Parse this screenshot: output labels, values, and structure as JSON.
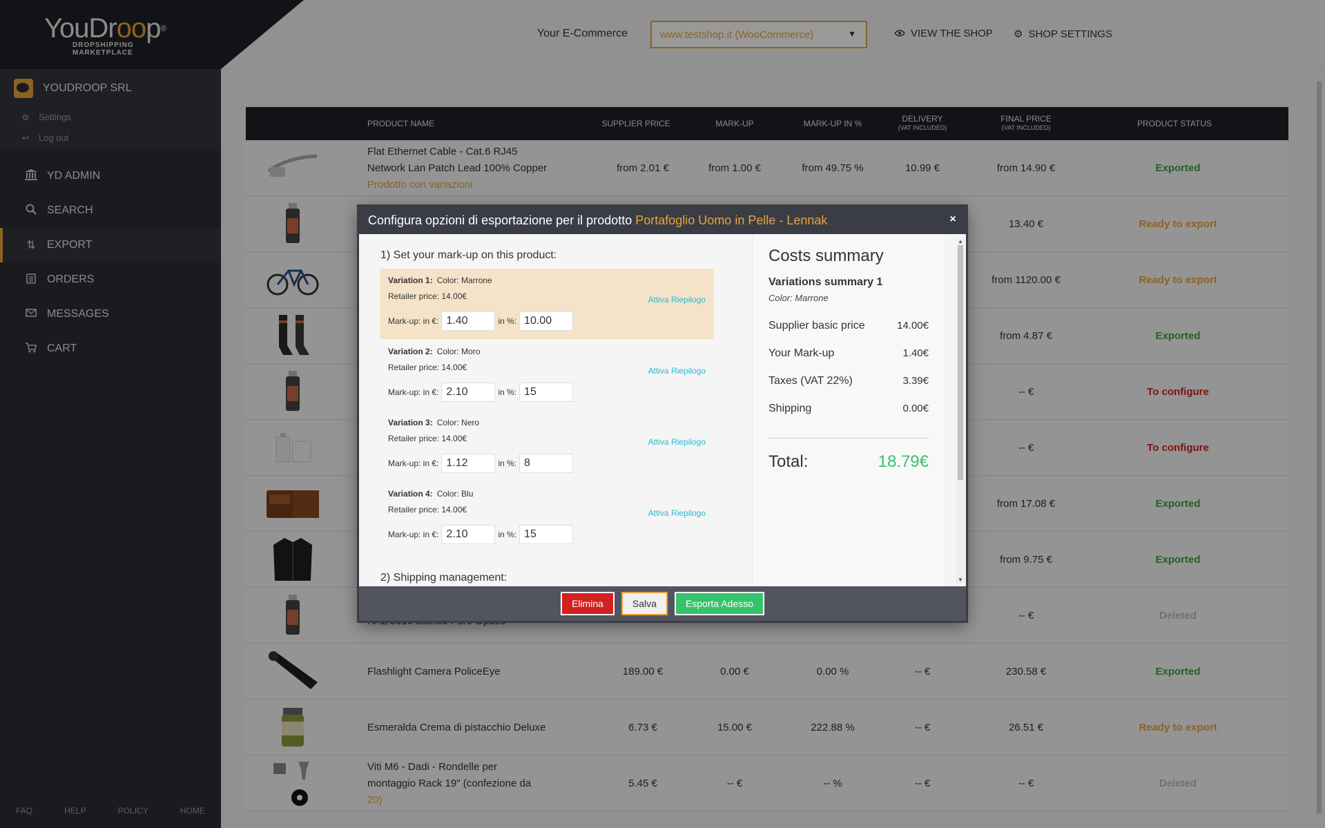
{
  "brand": {
    "name_a": "You",
    "name_b": "Dr",
    "name_c": "oo",
    "name_d": "p",
    "reg": "®",
    "tagline": "DROPSHIPPING MARKETPLACE"
  },
  "company": {
    "name": "YOUDROOP SRL",
    "settings": "Settings",
    "logout": "Log out"
  },
  "nav": [
    {
      "label": "YD ADMIN",
      "icon": "bank-icon"
    },
    {
      "label": "SEARCH",
      "icon": "search-icon"
    },
    {
      "label": "EXPORT",
      "icon": "export-icon"
    },
    {
      "label": "ORDERS",
      "icon": "clipboard-icon"
    },
    {
      "label": "MESSAGES",
      "icon": "mail-icon"
    },
    {
      "label": "CART",
      "icon": "cart-icon"
    }
  ],
  "footer": {
    "faq": "FAQ",
    "help": "HELP",
    "policy": "POLICY",
    "home": "HOME"
  },
  "topbar": {
    "shop_label": "Your E-Commerce",
    "shop_value": "www.testshop.it (WooCommerce)",
    "view_shop": "VIEW THE SHOP",
    "shop_settings": "SHOP SETTINGS"
  },
  "table": {
    "headers": {
      "name": "PRODUCT NAME",
      "supplier": "SUPPLIER PRICE",
      "markup": "MARK-UP",
      "markup_pct": "MARK-UP IN %",
      "delivery": "DELIVERY",
      "delivery_sub": "(VAT INCLUDED)",
      "final": "FINAL PRICE",
      "final_sub": "(VAT INCLUDED)",
      "status": "PRODUCT STATUS"
    },
    "rows": [
      {
        "name1": "Flat Ethernet Cable - Cat.6 RJ45",
        "name2": "Network Lan Patch Lead 100% Copper",
        "name3": "Prodotto con variazioni",
        "supplier": "from 2.01 €",
        "markup": "from 1.00 €",
        "markup_pct": "from 49.75 %",
        "delivery": "10.99 €",
        "final": "from 14.90 €",
        "status": "Exported",
        "status_type": "exported"
      },
      {
        "name1": "",
        "name2": "",
        "name3": "",
        "supplier": "",
        "markup": "",
        "markup_pct": "",
        "delivery": "",
        "final": "13.40 €",
        "status": "Ready to export",
        "status_type": "ready"
      },
      {
        "name1": "",
        "name2": "",
        "name3": "",
        "supplier": "",
        "markup": "",
        "markup_pct": "",
        "delivery": "",
        "final": "from 1120.00 €",
        "status": "Ready to export",
        "status_type": "ready"
      },
      {
        "name1": "",
        "name2": "",
        "name3": "",
        "supplier": "",
        "markup": "",
        "markup_pct": "",
        "delivery": "",
        "final": "from 4.87 €",
        "status": "Exported",
        "status_type": "exported"
      },
      {
        "name1": "",
        "name2": "",
        "name3": "",
        "supplier": "",
        "markup": "",
        "markup_pct": "",
        "delivery": "",
        "final": "-- €",
        "status": "To configure",
        "status_type": "config"
      },
      {
        "name1": "",
        "name2": "",
        "name3": "",
        "supplier": "",
        "markup": "",
        "markup_pct": "",
        "delivery": "",
        "final": "-- €",
        "status": "To configure",
        "status_type": "config"
      },
      {
        "name1": "",
        "name2": "",
        "name3": "",
        "supplier": "",
        "markup": "",
        "markup_pct": "",
        "delivery": "",
        "final": "from 17.08 €",
        "status": "Exported",
        "status_type": "exported"
      },
      {
        "name1": "",
        "name2": "",
        "name3": "",
        "supplier": "",
        "markup": "",
        "markup_pct": "",
        "delivery": "",
        "final": "from 9.75 €",
        "status": "Exported",
        "status_type": "exported"
      },
      {
        "name1": "",
        "name2": "RAL 9016 Bianco Puro Opaco",
        "name3": "",
        "supplier": "",
        "markup": "",
        "markup_pct": "",
        "delivery": "",
        "final": "-- €",
        "status": "Deleted",
        "status_type": "deleted"
      },
      {
        "name1": "Flashlight Camera PoliceEye",
        "name2": "",
        "name3": "",
        "supplier": "189.00 €",
        "markup": "0.00 €",
        "markup_pct": "0.00 %",
        "delivery": "-- €",
        "final": "230.58 €",
        "status": "Exported",
        "status_type": "exported"
      },
      {
        "name1": "Esmeralda Crema di pistacchio Deluxe",
        "name2": "",
        "name3": "",
        "supplier": "6.73 €",
        "markup": "15.00 €",
        "markup_pct": "222.88 %",
        "delivery": "-- €",
        "final": "26.51 €",
        "status": "Ready to export",
        "status_type": "ready"
      },
      {
        "name1": "Viti M6 - Dadi - Rondelle per",
        "name2": "montaggio Rack 19\" (confezione da",
        "name3": "20)",
        "supplier": "5.45 €",
        "markup": "-- €",
        "markup_pct": "-- %",
        "delivery": "-- €",
        "final": "-- €",
        "status": "Deleted",
        "status_type": "deleted"
      }
    ]
  },
  "modal": {
    "title": "Configura opzioni di esportazione per il prodotto",
    "product": "Portafoglio Uomo in Pelle - Lennak",
    "close": "×",
    "section1": "1) Set your mark-up on this product:",
    "section2": "2) Shipping management:",
    "variations": [
      {
        "title": "Variation 1:",
        "color": "Color: Marrone",
        "retail": "Retailer price: 14.00€",
        "link": "Attiva Riepilogo",
        "label_eur": "Mark-up: in €:",
        "eur": "1.40",
        "label_pct": "in %:",
        "pct": "10.00"
      },
      {
        "title": "Variation 2:",
        "color": "Color: Moro",
        "retail": "Retailer price: 14.00€",
        "link": "Attiva Riepilogo",
        "label_eur": "Mark-up: in €:",
        "eur": "2.10",
        "label_pct": "in %:",
        "pct": "15"
      },
      {
        "title": "Variation 3:",
        "color": "Color: Nero",
        "retail": "Retailer price: 14.00€",
        "link": "Attiva Riepilogo",
        "label_eur": "Mark-up: in €:",
        "eur": "1.12",
        "label_pct": "in %:",
        "pct": "8"
      },
      {
        "title": "Variation 4:",
        "color": "Color: Blu",
        "retail": "Retailer price: 14.00€",
        "link": "Attiva Riepilogo",
        "label_eur": "Mark-up: in €:",
        "eur": "2.10",
        "label_pct": "in %:",
        "pct": "15"
      }
    ],
    "summary": {
      "title": "Costs summary",
      "sub": "Variations summary 1",
      "color": "Color: Marrone",
      "lines": [
        {
          "label": "Supplier basic price",
          "value": "14.00€"
        },
        {
          "label": "Your Mark-up",
          "value": "1.40€"
        },
        {
          "label": "Taxes (VAT  22%)",
          "value": "3.39€"
        },
        {
          "label": "Shipping",
          "value": "0.00€"
        }
      ],
      "total_label": "Total:",
      "total_value": "18.79€"
    },
    "buttons": {
      "delete": "Elimina",
      "save": "Salva",
      "export": "Esporta Adesso"
    }
  },
  "colors": {
    "accent": "#e8a33d",
    "dark": "#1f2126",
    "sidebar": "#2a2d33",
    "exported": "#3fa13f",
    "config": "#d32020",
    "link": "#29b6d6",
    "total": "#35c46b"
  }
}
